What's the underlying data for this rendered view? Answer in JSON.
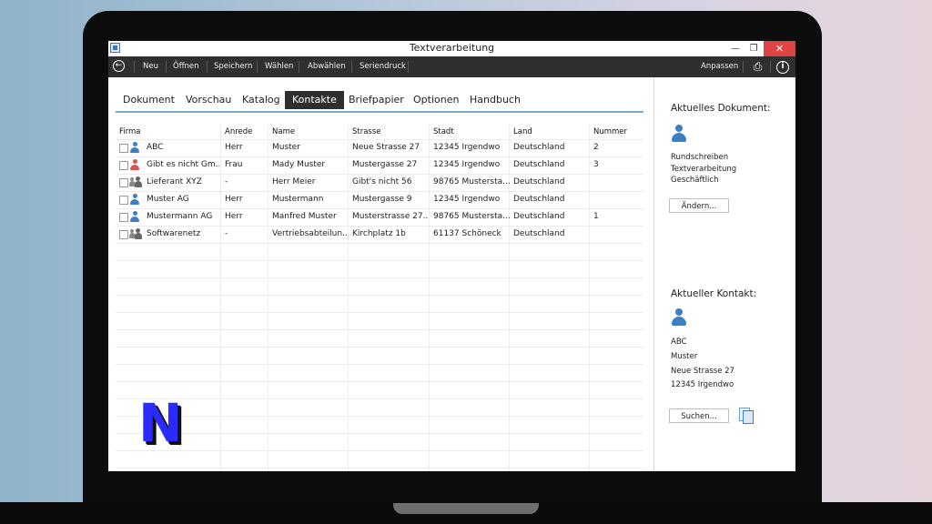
{
  "window": {
    "title": "Textverarbeitung",
    "min_icon": "minimize-icon",
    "max_icon": "restore-icon",
    "close_icon": "close-icon"
  },
  "toolbar": {
    "items": [
      "Neu",
      "Öffnen",
      "Speichern",
      "Wählen",
      "Abwählen",
      "Seriendruck"
    ],
    "right_label": "Anpassen",
    "icons": [
      "back-arrow-icon",
      "printer-icon",
      "info-icon"
    ]
  },
  "tabs": [
    "Dokument",
    "Vorschau",
    "Katalog",
    "Kontakte",
    "Briefpapier",
    "Optionen",
    "Handbuch"
  ],
  "active_tab": "Kontakte",
  "table": {
    "columns": [
      "Firma",
      "Anrede",
      "Name",
      "Strasse",
      "Stadt",
      "Land",
      "Nummer"
    ],
    "rows": [
      {
        "icon": "person-blue",
        "firma": "ABC",
        "anrede": "Herr",
        "name": "Muster",
        "strasse": "Neue Strasse 27",
        "stadt": "12345 Irgendwo",
        "land": "Deutschland",
        "nummer": "2"
      },
      {
        "icon": "person-red",
        "firma": "Gibt es nicht Gm...",
        "anrede": "Frau",
        "name": "Mady Muster",
        "strasse": "Mustergasse 27",
        "stadt": "12345 Irgendwo",
        "land": "Deutschland",
        "nummer": "3"
      },
      {
        "icon": "group",
        "firma": "Lieferant XYZ",
        "anrede": "-",
        "name": "Herr Meier",
        "strasse": "Gibt's nicht 56",
        "stadt": "98765 Mustersta...",
        "land": "Deutschland",
        "nummer": ""
      },
      {
        "icon": "person-blue",
        "firma": "Muster AG",
        "anrede": "Herr",
        "name": "Mustermann",
        "strasse": "Mustergasse 9",
        "stadt": "12345 Irgendwo",
        "land": "Deutschland",
        "nummer": ""
      },
      {
        "icon": "person-blue",
        "firma": "Mustermann AG",
        "anrede": "Herr",
        "name": "Manfred Muster",
        "strasse": "Musterstrasse 27...",
        "stadt": "98765 Mustersta...",
        "land": "Deutschland",
        "nummer": "1"
      },
      {
        "icon": "group",
        "firma": "Softwarenetz",
        "anrede": "-",
        "name": "Vertriebsabteilun...",
        "strasse": "Kirchplatz 1b",
        "stadt": "61137 Schöneck",
        "land": "Deutschland",
        "nummer": ""
      }
    ]
  },
  "sidebar": {
    "doc_heading": "Aktuelles Dokument:",
    "doc_lines": [
      "Rundschreiben",
      "Textverarbeitung",
      "Geschäftlich"
    ],
    "change_button": "Ändern...",
    "contact_heading": "Aktueller Kontakt:",
    "contact_lines": [
      "ABC",
      "Muster",
      "Neue Strasse 27",
      "12345 Irgendwo"
    ],
    "search_button": "Suchen...",
    "copy_icon": "copy-document-icon"
  },
  "overlay": {
    "logo_letter": "N"
  },
  "colors": {
    "toolbar_bg": "#2f2f2f",
    "tab_rule": "#7fa7c8",
    "close_red": "#e04343",
    "person_blue": "#3d7ec4",
    "person_red": "#d9534f",
    "logo_blue": "#2b2bff"
  }
}
